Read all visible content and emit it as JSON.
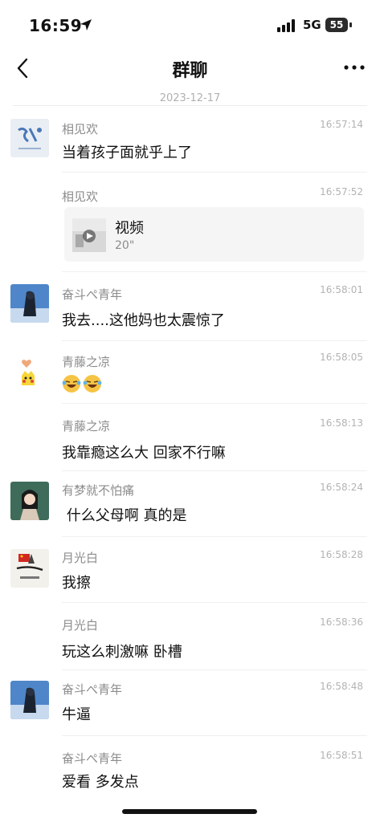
{
  "status_bar": {
    "time": "16:59",
    "network": "5G",
    "battery": "55"
  },
  "nav": {
    "title": "群聊"
  },
  "date_separator": "2023-12-17",
  "messages": [
    {
      "sender": "相见欢",
      "time": "16:57:14",
      "text": "当着孩子面就乎上了"
    },
    {
      "sender": "相见欢",
      "time": "16:57:52",
      "video_title": "视频",
      "video_duration": "20\""
    },
    {
      "sender": "奋斗ぺ青年",
      "time": "16:58:01",
      "text": "我去....这他妈也太震惊了"
    },
    {
      "sender": "青藤之凉",
      "time": "16:58:05",
      "emojis": [
        "laughing-crying-emoji",
        "laughing-crying-emoji"
      ]
    },
    {
      "sender": "青藤之凉",
      "time": "16:58:13",
      "text": "我靠瘾这么大 回家不行嘛"
    },
    {
      "sender": "有梦就不怕痛",
      "time": "16:58:24",
      "text": " 什么父母啊 真的是"
    },
    {
      "sender": "月光白",
      "time": "16:58:28",
      "text": "我擦"
    },
    {
      "sender": "月光白",
      "time": "16:58:36",
      "text": "玩这么刺激嘛 卧槽"
    },
    {
      "sender": "奋斗ぺ青年",
      "time": "16:58:48",
      "text": "牛逼"
    },
    {
      "sender": "奋斗ぺ青年",
      "time": "16:58:51",
      "text": "爱看 多发点"
    }
  ],
  "colors": {
    "accent_text": "#111111",
    "meta_text": "#8c8c8c",
    "time_text": "#b3b3b3"
  }
}
